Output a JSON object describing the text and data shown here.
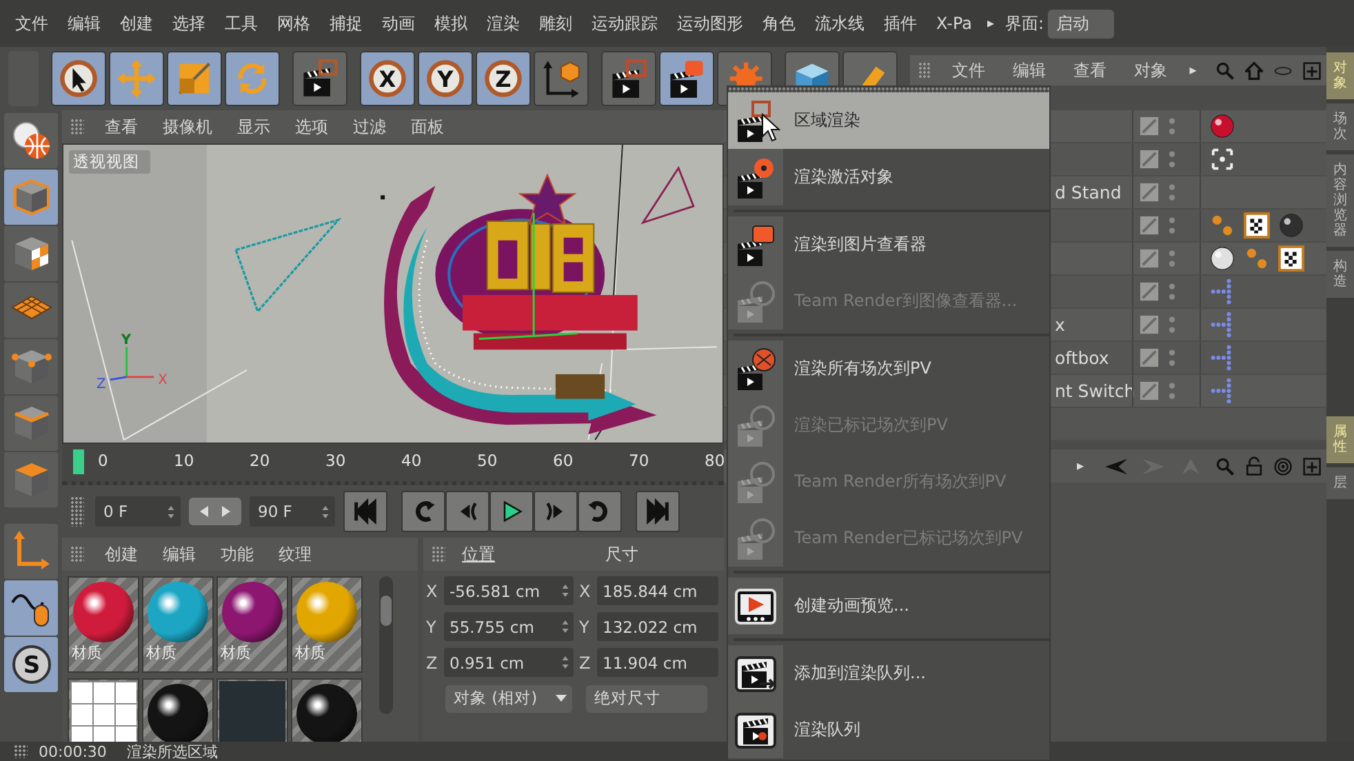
{
  "menubar": {
    "items": [
      "文件",
      "编辑",
      "创建",
      "选择",
      "工具",
      "网格",
      "捕捉",
      "动画",
      "模拟",
      "渲染",
      "雕刻",
      "运动跟踪",
      "运动图形",
      "角色",
      "流水线",
      "插件",
      "X-Pa"
    ],
    "more": "▸",
    "layout_label": "界面:",
    "layout_value": "启动"
  },
  "toolbar": [
    {
      "selected": true
    },
    {
      "selected": true
    },
    {
      "selected": true
    },
    {
      "selected": true
    },
    {
      "selected": false
    },
    {
      "label": "X",
      "selected": true
    },
    {
      "label": "Y",
      "selected": true
    },
    {
      "label": "Z",
      "selected": true
    },
    {
      "selected": false
    },
    {
      "selected": false
    },
    {
      "selected": true
    },
    {
      "selected": false
    },
    {
      "selected": false
    },
    {
      "selected": false
    }
  ],
  "object_manager": {
    "menu": [
      "文件",
      "编辑",
      "查看",
      "对象"
    ],
    "more": "▸",
    "rows": [
      {
        "tags": [
          {
            "kind": "material",
            "color": "#c8102e"
          }
        ]
      },
      {
        "tags": [
          {
            "kind": "compositing"
          }
        ]
      },
      {
        "name": "d Stand",
        "tags": []
      },
      {
        "tags": [
          {
            "kind": "phong"
          },
          {
            "kind": "checker"
          },
          {
            "kind": "material",
            "color": "#303030"
          }
        ]
      },
      {
        "tags": [
          {
            "kind": "material",
            "color": "#e0e0e0"
          },
          {
            "kind": "phong"
          },
          {
            "kind": "checker"
          }
        ]
      },
      {
        "tags": [
          {
            "kind": "xpresso"
          }
        ]
      },
      {
        "name": "x",
        "tags": [
          {
            "kind": "xpresso"
          }
        ]
      },
      {
        "name": "oftbox",
        "tags": [
          {
            "kind": "xpresso"
          }
        ]
      },
      {
        "name": "nt Switch",
        "tags": [
          {
            "kind": "xpresso"
          }
        ]
      }
    ]
  },
  "attribute_manager": {
    "more": "▸"
  },
  "side_tabs": [
    {
      "label": "对象",
      "selected": true
    },
    {
      "label": "场次",
      "selected": false
    },
    {
      "label": "内容浏览器",
      "selected": false
    },
    {
      "label": "构造",
      "selected": false
    },
    {
      "label": "属性",
      "selected": true
    },
    {
      "label": "层",
      "selected": false
    }
  ],
  "left_tools": [
    {
      "selected": false
    },
    {
      "selected": true
    },
    {
      "selected": false
    },
    {
      "selected": false
    },
    {
      "selected": false
    },
    {
      "selected": false
    },
    {
      "selected": false
    },
    {
      "selected": false
    },
    {
      "selected": true
    },
    {
      "label": "S",
      "selected": true
    }
  ],
  "viewport": {
    "menu": [
      "查看",
      "摄像机",
      "显示",
      "选项",
      "过滤",
      "面板"
    ],
    "view_label": "透视视图",
    "axis_y": "Y",
    "axis_z": "Z",
    "axis_x": "X"
  },
  "timeline": {
    "ticks": [
      "0",
      "10",
      "20",
      "30",
      "40",
      "50",
      "60",
      "70",
      "80"
    ],
    "level": 0
  },
  "playback": {
    "start": "0 F",
    "end": "90 F"
  },
  "materials": {
    "menu": [
      "创建",
      "编辑",
      "功能",
      "纹理"
    ],
    "items": [
      {
        "kind": "sphere",
        "color": "#d01c3c",
        "name": "材质"
      },
      {
        "kind": "sphere",
        "color": "#1ca6c4",
        "name": "材质"
      },
      {
        "kind": "sphere",
        "color": "#8c1670",
        "name": "材质"
      },
      {
        "kind": "sphere",
        "color": "#e2a600",
        "name": "材质"
      },
      {
        "kind": "tiles"
      },
      {
        "kind": "sphere",
        "color": "#141414"
      },
      {
        "kind": "flat",
        "color": "#263034"
      },
      {
        "kind": "sphere",
        "color": "#141414"
      }
    ]
  },
  "coordinates": {
    "headers": [
      "位置",
      "尺寸"
    ],
    "rows": [
      {
        "axis": "X",
        "position": "-56.581 cm",
        "size_axis": "X",
        "size": "185.844 cm"
      },
      {
        "axis": "Y",
        "position": "55.755 cm",
        "size_axis": "Y",
        "size": "132.022 cm"
      },
      {
        "axis": "Z",
        "position": "0.951 cm",
        "size_axis": "Z",
        "size": "11.904 cm"
      }
    ],
    "mode": "对象 (相对)",
    "size_mode": "绝对尺寸"
  },
  "render_menu": {
    "groups": [
      [
        {
          "kind": "region",
          "label": "区域渲染",
          "selected": true,
          "disabled": false
        },
        {
          "kind": "active",
          "label": "渲染激活对象",
          "selected": false,
          "disabled": false
        }
      ],
      [
        {
          "kind": "viewer",
          "label": "渲染到图片查看器",
          "selected": false,
          "disabled": false
        },
        {
          "kind": "team",
          "label": "Team Render到图像查看器...",
          "selected": false,
          "disabled": true
        }
      ],
      [
        {
          "kind": "takes",
          "label": "渲染所有场次到PV",
          "selected": false,
          "disabled": false
        },
        {
          "kind": "team",
          "label": "渲染已标记场次到PV",
          "selected": false,
          "disabled": true
        },
        {
          "kind": "team",
          "label": "Team Render所有场次到PV",
          "selected": false,
          "disabled": true
        },
        {
          "kind": "team",
          "label": "Team Render已标记场次到PV",
          "selected": false,
          "disabled": true
        }
      ],
      [
        {
          "kind": "preview",
          "label": "创建动画预览...",
          "selected": false,
          "disabled": false
        }
      ],
      [
        {
          "kind": "queue_add",
          "label": "添加到渲染队列...",
          "selected": false,
          "disabled": false
        },
        {
          "kind": "queue",
          "label": "渲染队列",
          "selected": false,
          "disabled": false
        }
      ]
    ]
  },
  "status_bar": {
    "time": "00:00:30",
    "message": "渲染所选区域"
  }
}
